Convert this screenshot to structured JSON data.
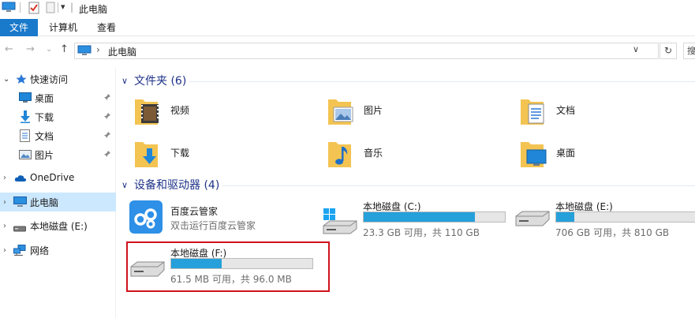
{
  "window": {
    "title": "此电脑"
  },
  "quick_access": {
    "separator": "|",
    "dropdown": "▾"
  },
  "ribbon": {
    "tabs": [
      "文件",
      "计算机",
      "查看"
    ]
  },
  "nav": {
    "back": "←",
    "forward": "→",
    "recent": "⌄",
    "up": "↑",
    "address_chevron": "›",
    "address_text": "此电脑",
    "address_dropdown": "∨",
    "refresh": "↻",
    "search_hint": "搜"
  },
  "sidebar": {
    "items": [
      {
        "label": "快速访问",
        "icon": "star-icon",
        "pinned": false
      },
      {
        "label": "桌面",
        "icon": "desktop-icon",
        "pinned": true
      },
      {
        "label": "下载",
        "icon": "download-icon",
        "pinned": true
      },
      {
        "label": "文档",
        "icon": "document-icon",
        "pinned": true
      },
      {
        "label": "图片",
        "icon": "picture-icon",
        "pinned": true
      },
      {
        "label": "OneDrive",
        "icon": "cloud-icon",
        "pinned": false
      },
      {
        "label": "此电脑",
        "icon": "computer-icon",
        "pinned": false
      },
      {
        "label": "本地磁盘 (E:)",
        "icon": "drive-icon",
        "pinned": false
      },
      {
        "label": "网络",
        "icon": "network-icon",
        "pinned": false
      }
    ],
    "pin_glyph": "📌"
  },
  "content": {
    "folders_header": "文件夹 (6)",
    "folders": [
      {
        "label": "视频",
        "icon": "video-folder-icon"
      },
      {
        "label": "图片",
        "icon": "picture-folder-icon"
      },
      {
        "label": "文档",
        "icon": "document-folder-icon"
      },
      {
        "label": "下载",
        "icon": "download-folder-icon"
      },
      {
        "label": "音乐",
        "icon": "music-folder-icon"
      },
      {
        "label": "桌面",
        "icon": "desktop-folder-icon"
      }
    ],
    "devices_header": "设备和驱动器 (4)",
    "devices": [
      {
        "name": "百度云管家",
        "sub": "双击运行百度云管家",
        "icon": "baidu-cloud-icon"
      },
      {
        "name": "本地磁盘 (C:)",
        "sub": "23.3 GB 可用，共 110 GB",
        "icon": "windows-drive-icon",
        "used_fraction": 0.79
      },
      {
        "name": "本地磁盘 (E:)",
        "sub": "706 GB 可用，共 810 GB",
        "icon": "hdd-icon",
        "used_fraction": 0.13
      },
      {
        "name": "本地磁盘 (F:)",
        "sub": "61.5 MB 可用，共 96.0 MB",
        "icon": "hdd-icon",
        "used_fraction": 0.36
      }
    ]
  },
  "colors": {
    "accent": "#1979ca",
    "header_text": "#1e3287",
    "selection": "#cce8ff",
    "bar_fill": "#26a0da",
    "highlight": "#d0121b"
  }
}
